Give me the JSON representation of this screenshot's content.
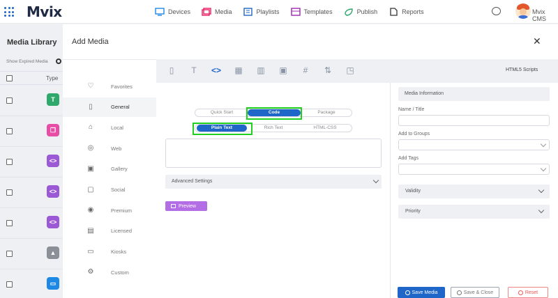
{
  "app": {
    "brand": "Mvix",
    "user_name": "Mvix CMS"
  },
  "nav": [
    {
      "label": "Devices",
      "icon": "monitor-icon",
      "color": "#1e88e5"
    },
    {
      "label": "Media",
      "icon": "media-icon",
      "color": "#e91e63"
    },
    {
      "label": "Playlists",
      "icon": "playlist-icon",
      "color": "#1e66c8"
    },
    {
      "label": "Templates",
      "icon": "template-icon",
      "color": "#9c27b0"
    },
    {
      "label": "Publish",
      "icon": "publish-icon",
      "color": "#2ea86b"
    },
    {
      "label": "Reports",
      "icon": "report-icon",
      "color": "#333333"
    }
  ],
  "library": {
    "title": "Media Library",
    "show_expired": "Show Expired Media",
    "type_header": "Type",
    "rows": [
      {
        "glyph": "T",
        "color": "#2ea86b"
      },
      {
        "glyph": "❐",
        "color": "#e84da5"
      },
      {
        "glyph": "<>",
        "color": "#9b59d6"
      },
      {
        "glyph": "<>",
        "color": "#9b59d6"
      },
      {
        "glyph": "<>",
        "color": "#9b59d6"
      },
      {
        "glyph": "▲",
        "color": "#8a8f98"
      },
      {
        "glyph": "▭",
        "color": "#1e88e5"
      }
    ]
  },
  "modal": {
    "title": "Add Media",
    "close": "✕",
    "categories": [
      {
        "label": "Favorites",
        "icon": "♡"
      },
      {
        "label": "General",
        "icon": "▯"
      },
      {
        "label": "Local",
        "icon": "⌂"
      },
      {
        "label": "Web",
        "icon": "◎"
      },
      {
        "label": "Gallery",
        "icon": "▣"
      },
      {
        "label": "Social",
        "icon": "▢"
      },
      {
        "label": "Premium",
        "icon": "◉"
      },
      {
        "label": "Licensed",
        "icon": "▤"
      },
      {
        "label": "Kiosks",
        "icon": "▭"
      },
      {
        "label": "Custom",
        "icon": "⚙"
      }
    ],
    "active_category": "General",
    "toolbar_icons": [
      "▯",
      "T",
      "<>",
      "▦",
      "▥",
      "▣",
      "#",
      "⇅",
      "◳"
    ],
    "toolbar_label": "HTML5 Scripts",
    "mode_tabs": [
      "Quick Start",
      "Code",
      "Package"
    ],
    "active_mode": "Code",
    "format_tabs": [
      "Plain Text",
      "Rich Text",
      "HTML-CSS"
    ],
    "active_format": "Plain Text",
    "advanced_settings": "Advanced Settings",
    "preview_label": "Preview",
    "info": {
      "header": "Media Information",
      "name_label": "Name / Title",
      "groups_label": "Add to Groups",
      "tags_label": "Add Tags",
      "validity": "Validity",
      "priority": "Priority"
    },
    "buttons": {
      "save_media": "Save Media",
      "save_close": "Save & Close",
      "reset": "Reset"
    }
  },
  "colors": {
    "accent": "#1e66c8",
    "highlight": "#1fd01f",
    "preview": "#b36ee6"
  }
}
